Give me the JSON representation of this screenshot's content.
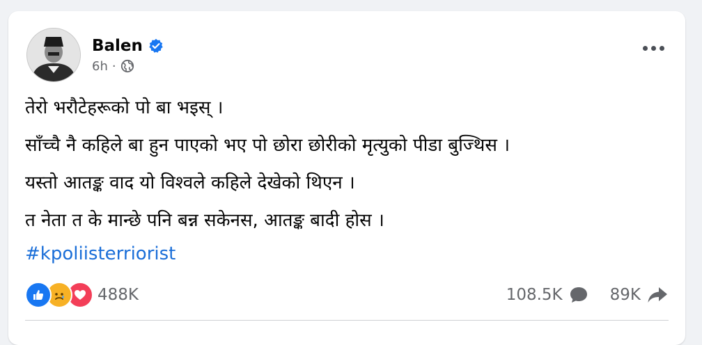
{
  "post": {
    "author": "Balen",
    "time": "6h",
    "separator": "·",
    "lines": [
      "तेरो भरौटेहरूको पो बा भइस् ।",
      "साँच्चै नै कहिले बा हुन पाएको  भए पो छोरा छोरीको मृत्युको पीडा बुज्थिस ।",
      "यस्तो आतङ्क वाद यो विश्वले कहिले देखेको थिएन ।",
      "त नेता त के मान्छे पनि बन्न सकेनस, आतङ्क बादी होस ।"
    ],
    "hashtag": "#kpoliisterriorist"
  },
  "stats": {
    "reactions_count": "488K",
    "comments_count": "108.5K",
    "shares_count": "89K",
    "reaction_icons": [
      "like-icon",
      "sad-icon",
      "love-icon"
    ]
  },
  "icons": {
    "verified": "verified-badge-icon",
    "audience": "globe-icon",
    "more": "more-options-icon",
    "comment": "comment-icon",
    "share": "share-icon"
  },
  "colors": {
    "link": "#1a6ed8",
    "verified": "#1877f2",
    "like": "#1877f2",
    "love": "#f33e58",
    "sad": "#f7b125",
    "muted": "#65676b"
  }
}
